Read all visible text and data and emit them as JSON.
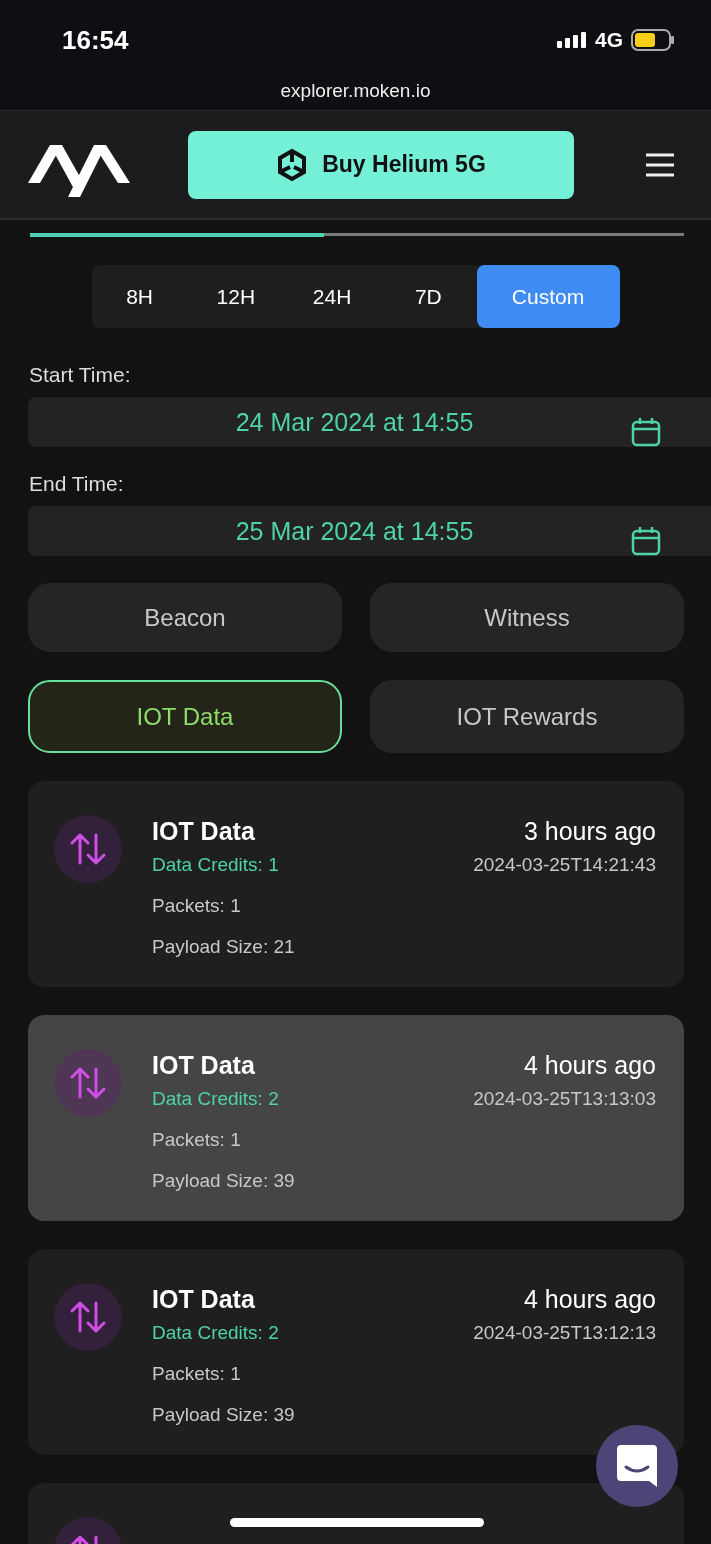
{
  "status_bar": {
    "time": "16:54",
    "network": "4G"
  },
  "address_bar": {
    "url": "explorer.moken.io"
  },
  "header": {
    "buy_button": "Buy Helium 5G"
  },
  "progress": {
    "level": 0.45
  },
  "periods": [
    {
      "label": "8H",
      "selected": false
    },
    {
      "label": "12H",
      "selected": false
    },
    {
      "label": "24H",
      "selected": false
    },
    {
      "label": "7D",
      "selected": false
    },
    {
      "label": "Custom",
      "selected": true
    }
  ],
  "start_time": {
    "label": "Start Time:",
    "value": "24 Mar 2024 at 14:55"
  },
  "end_time": {
    "label": "End Time:",
    "value": "25 Mar 2024 at 14:55"
  },
  "filters": [
    {
      "label": "Beacon",
      "selected": false
    },
    {
      "label": "Witness",
      "selected": false
    },
    {
      "label": "IOT Data",
      "selected": true
    },
    {
      "label": "IOT Rewards",
      "selected": false
    }
  ],
  "events": [
    {
      "title": "IOT Data",
      "credits": "Data Credits: 1",
      "packets": "Packets: 1",
      "payload": "Payload Size: 21",
      "ago": "3 hours ago",
      "timestamp": "2024-03-25T14:21:43",
      "selected": false
    },
    {
      "title": "IOT Data",
      "credits": "Data Credits: 2",
      "packets": "Packets: 1",
      "payload": "Payload Size: 39",
      "ago": "4 hours ago",
      "timestamp": "2024-03-25T13:13:03",
      "selected": true
    },
    {
      "title": "IOT Data",
      "credits": "Data Credits: 2",
      "packets": "Packets: 1",
      "payload": "Payload Size: 39",
      "ago": "4 hours ago",
      "timestamp": "2024-03-25T13:12:13",
      "selected": false
    },
    {
      "selected": false
    }
  ]
}
